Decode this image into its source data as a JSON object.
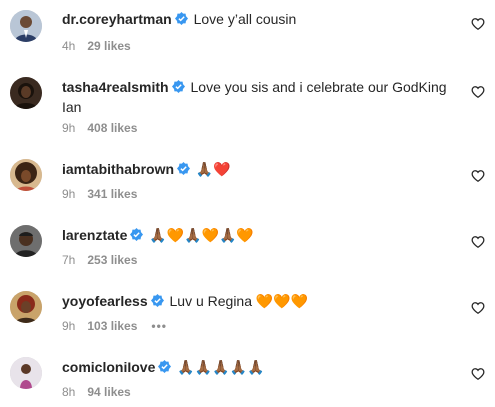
{
  "colors": {
    "verified_badge": "#3897f0",
    "meta_text": "#8e8e8e",
    "text": "#262626",
    "heart_outline": "#262626"
  },
  "comments": [
    {
      "username": "dr.coreyhartman",
      "verified": true,
      "text": "Love y’all cousin",
      "time": "4h",
      "likes": "29 likes",
      "avatar_icon": "profile-photo"
    },
    {
      "username": "tasha4realsmith",
      "verified": true,
      "text": "Love you sis and i celebrate our GodKing Ian",
      "time": "9h",
      "likes": "408 likes",
      "avatar_icon": "profile-photo"
    },
    {
      "username": "iamtabithabrown",
      "verified": true,
      "text": "🙏🏾❤️",
      "time": "9h",
      "likes": "341 likes",
      "avatar_icon": "profile-photo"
    },
    {
      "username": "larenztate",
      "verified": true,
      "text": "🙏🏾🧡🙏🏾🧡🙏🏾🧡",
      "time": "7h",
      "likes": "253 likes",
      "avatar_icon": "profile-photo"
    },
    {
      "username": "yoyofearless",
      "verified": true,
      "text": "Luv u Regina 🧡🧡🧡",
      "time": "9h",
      "likes": "103 likes",
      "more": "•••",
      "avatar_icon": "profile-photo"
    },
    {
      "username": "comicloniIove",
      "verified": true,
      "text": "🙏🏾🙏🏾🙏🏾🙏🏾🙏🏾",
      "time": "8h",
      "likes": "94 likes",
      "avatar_icon": "profile-photo"
    }
  ]
}
